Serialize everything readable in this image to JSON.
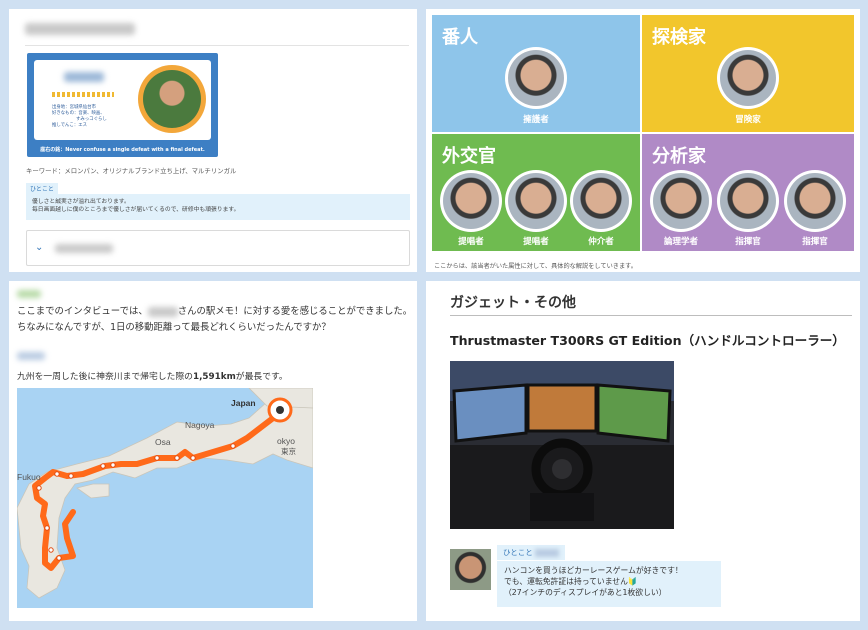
{
  "panel_profile": {
    "card_lines": [
      "出身地：宮城県仙台市",
      "好きなもの：音楽、映画、",
      "すみっコぐらし",
      "推しでんこ：エス"
    ],
    "card_motto": "座右の銘：Never confuse a single defeat with a final defeat.",
    "keywords": "キーワード：メロンパン、オリジナルブランド立ち上げ、マルチリンガル",
    "memo_label": "ひとこと",
    "memo_lines": [
      "優しさと誠実さが溢れ出ております。",
      "毎日画面越しに僕のところまで優しさが届いてくるので、研修中も頑張ります。"
    ],
    "accordion_icon": "chevron-down-icon"
  },
  "panel_types": {
    "quadrants": [
      {
        "title": "番人",
        "color": "#8ec5ea",
        "members": [
          "擁護者"
        ]
      },
      {
        "title": "探検家",
        "color": "#f2c62c",
        "members": [
          "冒険家"
        ]
      },
      {
        "title": "外交官",
        "color": "#6fbb50",
        "members": [
          "提唱者",
          "提唱者",
          "仲介者"
        ]
      },
      {
        "title": "分析家",
        "color": "#b08ac6",
        "members": [
          "論理学者",
          "指揮官",
          "指揮官"
        ]
      }
    ],
    "footer": "ここからは、該当者がいた属性に対して、具体的な解説をしていきます。"
  },
  "panel_interview": {
    "question_lines": [
      "ここまでのインタビューでは、",
      "さんの駅メモ！に対する愛を感じることができました。",
      "ちなみになんですが、1日の移動距離って最長どれくらいだったんですか？"
    ],
    "answer_pre": "九州を一周した後に神奈川まで帰宅した際の",
    "answer_bold": "1,591km",
    "answer_post": "が最長です。",
    "map_labels": {
      "japan": "Japan",
      "nagoya": "Nagoya",
      "osaka": "Osa",
      "tokyo": "okyo",
      "tokyo_jp": "東京",
      "fukuoka": "Fukuo"
    }
  },
  "panel_gadget": {
    "heading": "ガジェット・その他",
    "product": "Thrustmaster T300RS GT Edition（ハンドルコントローラー）",
    "bubble_label": "ひとこと",
    "bubble_lines": [
      "ハンコンを買うほどカーレースゲームが好きです！",
      "でも、運転免許証は持っていません🔰",
      "（27インチのディスプレイがあと1枚欲しい）"
    ]
  }
}
